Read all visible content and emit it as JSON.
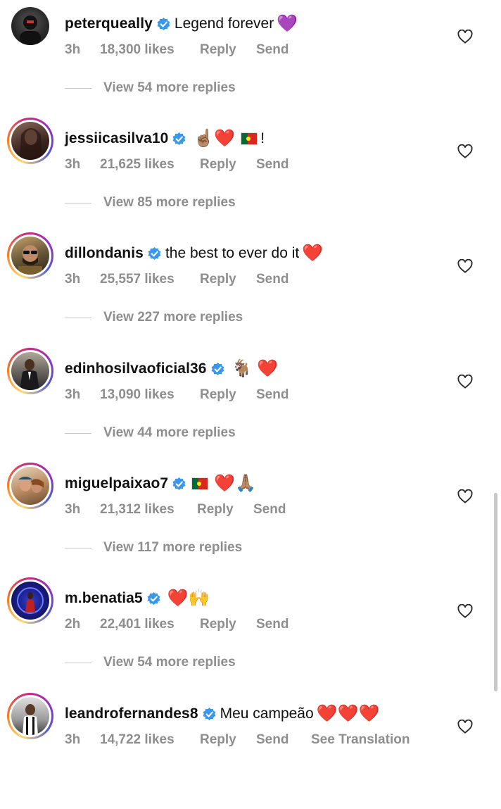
{
  "comments": [
    {
      "username": "peterqueally",
      "text": "Legend forever",
      "emoji": "💜",
      "flag": false,
      "time": "3h",
      "likes": "18,300 likes",
      "reply": "Reply",
      "send": "Send",
      "see_translation": "",
      "replies": "View 54 more replies",
      "avatar_style": "none",
      "avatar_color": "#2b2b2b"
    },
    {
      "username": "jessiicasilva10",
      "text": "",
      "emoji_before_flag": "☝🏽❤️",
      "flag": true,
      "emoji": "!",
      "time": "3h",
      "likes": "21,625 likes",
      "reply": "Reply",
      "send": "Send",
      "see_translation": "",
      "replies": "View 85 more replies",
      "avatar_style": "story",
      "avatar_color": "#5a3a30"
    },
    {
      "username": "dillondanis",
      "text": "the best to ever do it",
      "emoji": "❤️",
      "flag": false,
      "time": "3h",
      "likes": "25,557 likes",
      "reply": "Reply",
      "send": "Send",
      "see_translation": "",
      "replies": "View 227 more replies",
      "avatar_style": "story",
      "avatar_color": "#6b5a3a"
    },
    {
      "username": "edinhosilvaoficial36",
      "text": "",
      "emoji": "🐐 ❤️",
      "flag": false,
      "time": "3h",
      "likes": "13,090 likes",
      "reply": "Reply",
      "send": "Send",
      "see_translation": "",
      "replies": "View 44 more replies",
      "avatar_style": "story",
      "avatar_color": "#3a3f44"
    },
    {
      "username": "miguelpaixao7",
      "text": "",
      "emoji_before_flag": "",
      "flag": true,
      "emoji": "❤️🙏🏽",
      "time": "3h",
      "likes": "21,312 likes",
      "reply": "Reply",
      "send": "Send",
      "see_translation": "",
      "replies": "View 117 more replies",
      "avatar_style": "story",
      "avatar_color": "#b88a60"
    },
    {
      "username": "m.benatia5",
      "text": "",
      "emoji": "❤️🙌",
      "flag": false,
      "time": "2h",
      "likes": "22,401 likes",
      "reply": "Reply",
      "send": "Send",
      "see_translation": "",
      "replies": "View 54 more replies",
      "avatar_style": "story",
      "avatar_color": "#1b1f8a"
    },
    {
      "username": "leandrofernandes8",
      "text": "Meu campeão",
      "emoji": "❤️❤️❤️",
      "flag": false,
      "time": "3h",
      "likes": "14,722 likes",
      "reply": "Reply",
      "send": "Send",
      "see_translation": "See Translation",
      "replies": "",
      "avatar_style": "story",
      "avatar_color": "#4a4a4a"
    }
  ],
  "colors": {
    "verified": "#3897f0",
    "meta": "#8e8e8e",
    "text": "#111111"
  }
}
